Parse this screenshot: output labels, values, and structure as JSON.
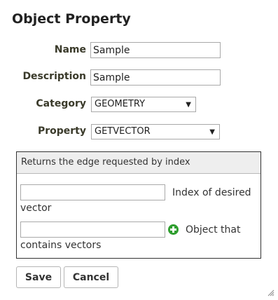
{
  "dialog": {
    "title": "Object Property"
  },
  "form": {
    "name_label": "Name",
    "name_value": "Sample",
    "description_label": "Description",
    "description_value": "Sample",
    "category_label": "Category",
    "category_value": "GEOMETRY",
    "property_label": "Property",
    "property_value": "GETVECTOR"
  },
  "panel": {
    "header": "Returns the edge requested by index",
    "params": [
      {
        "label_line1": "Index of desired",
        "label_line2": "vector",
        "value": ""
      },
      {
        "label_line1": "Object that",
        "label_line2": "contains vectors",
        "value": ""
      }
    ]
  },
  "buttons": {
    "save": "Save",
    "cancel": "Cancel"
  },
  "icons": {
    "add_param": "plus-circle-icon",
    "select_arrow": "caret-down-icon",
    "resize": "resize-grip-icon"
  },
  "colors": {
    "add_icon": "#2e9e2e",
    "panel_header_bg": "#eeeeee"
  }
}
